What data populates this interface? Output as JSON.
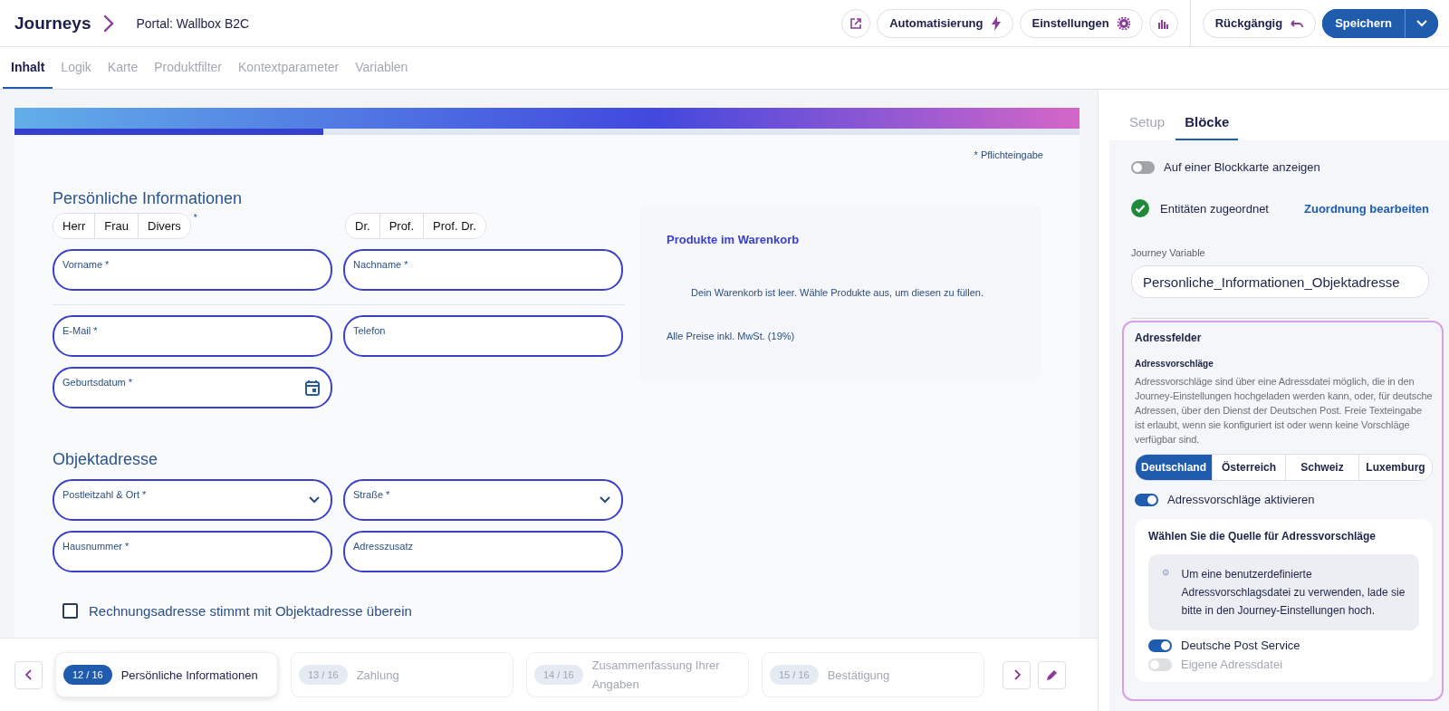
{
  "header": {
    "title": "Journeys",
    "subtitle": "Portal: Wallbox B2C",
    "buttons": [
      {
        "kind": "automation",
        "label": "Automatisierung"
      },
      {
        "kind": "settings",
        "label": "Einstellungen"
      }
    ],
    "undo": "Rückgängig",
    "save": "Speichern"
  },
  "tabs": [
    {
      "label": "Inhalt",
      "selected": true
    },
    {
      "label": "Logik",
      "selected": false
    },
    {
      "label": "Karte",
      "selected": false
    },
    {
      "label": "Produktfilter",
      "selected": false
    },
    {
      "label": "Kontextparameter",
      "selected": false
    },
    {
      "label": "Variablen",
      "selected": false
    }
  ],
  "progress": {
    "level": 0.29
  },
  "form": {
    "required_note": "* Pflichteingabe",
    "personal": {
      "title": "Persönliche Informationen",
      "salutations": [
        {
          "label": "Herr",
          "selected": false
        },
        {
          "label": "Frau",
          "selected": false
        },
        {
          "label": "Divers",
          "selected": false
        }
      ],
      "salutation_mark": "*",
      "titles": [
        {
          "label": "Dr.",
          "selected": false
        },
        {
          "label": "Prof.",
          "selected": false
        },
        {
          "label": "Prof. Dr.",
          "selected": false
        }
      ],
      "rows": [
        [
          {
            "label": "Vorname *",
            "kind": "text"
          },
          {
            "label": "Nachname *",
            "kind": "text"
          }
        ],
        [
          {
            "label": "E-Mail *",
            "kind": "text"
          },
          {
            "label": "Telefon",
            "kind": "text"
          }
        ],
        [
          {
            "label": "Geburtsdatum *",
            "kind": "date"
          }
        ]
      ]
    },
    "address": {
      "title": "Objektadresse",
      "rows": [
        [
          {
            "label": "Postleitzahl & Ort *",
            "kind": "select"
          },
          {
            "label": "Straße *",
            "kind": "select"
          }
        ],
        [
          {
            "label": "Hausnummer *",
            "kind": "text"
          },
          {
            "label": "Adresszusatz",
            "kind": "text"
          }
        ]
      ]
    },
    "billing_checkbox": {
      "label": "Rechnungsadresse stimmt mit Objektadresse überein",
      "checked": false
    },
    "cart": {
      "title": "Produkte im Warenkorb",
      "empty": "Dein Warenkorb ist leer. Wähle Produkte aus, um diesen zu füllen.",
      "note": "Alle Preise inkl. MwSt. (19%)"
    }
  },
  "steps": [
    {
      "badge": "12 / 16",
      "label": "Persönliche Informationen",
      "selected": true
    },
    {
      "badge": "13 / 16",
      "label": "Zahlung",
      "selected": false
    },
    {
      "badge": "14 / 16",
      "label": "Zusammenfassung Ihrer Angaben",
      "selected": false
    },
    {
      "badge": "15 / 16",
      "label": "Bestätigung",
      "selected": false
    }
  ],
  "panel": {
    "tabs": [
      {
        "label": "Setup",
        "selected": false
      },
      {
        "label": "Blöcke",
        "selected": true
      }
    ],
    "map_toggle": {
      "label": "Auf einer Blockkarte anzeigen",
      "on": false
    },
    "entities": {
      "label": "Entitäten zugeordnet",
      "link": "Zuordnung bearbeiten"
    },
    "variable": {
      "label": "Journey Variable",
      "value": "Personliche_Informationen_Objektadresse"
    },
    "address_fields": {
      "title": "Adressfelder",
      "subtitle": "Adressvorschläge",
      "description": "Adressvorschläge sind über eine Adressdatei möglich, die in den Journey-Einstellungen hochgeladen werden kann, oder, für deutsche Adressen, über den Dienst der Deutschen Post. Freie Texteingabe ist erlaubt, wenn sie konfiguriert ist oder wenn keine Vorschläge verfügbar sind.",
      "countries": [
        {
          "label": "Deutschland",
          "selected": true
        },
        {
          "label": "Österreich",
          "selected": false
        },
        {
          "label": "Schweiz",
          "selected": false
        },
        {
          "label": "Luxemburg",
          "selected": false
        }
      ],
      "suggest_toggle": {
        "label": "Adressvorschläge aktivieren",
        "on": true
      },
      "source": {
        "title": "Wählen Sie die Quelle für Adressvorschläge",
        "info": "Um eine benutzerdefinierte Adressvorschlagsdatei zu verwenden, lade sie bitte in den Journey-Einstellungen hoch.",
        "toggles": [
          {
            "label": "Deutsche Post Service",
            "on": true,
            "disabled": false
          },
          {
            "label": "Eigene Adressdatei",
            "on": false,
            "disabled": true
          }
        ]
      }
    }
  }
}
